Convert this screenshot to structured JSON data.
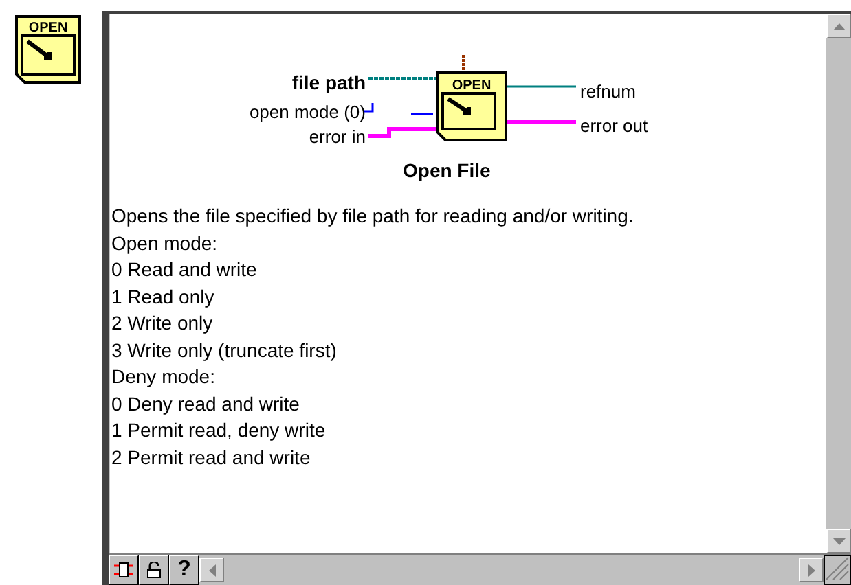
{
  "icon": {
    "label": "OPEN"
  },
  "diagram": {
    "node_label": "OPEN",
    "inputs": [
      {
        "label": "file path",
        "kind": "bold"
      },
      {
        "label": "open mode (0)",
        "kind": "plain"
      },
      {
        "label": "error in",
        "kind": "plain"
      }
    ],
    "outputs": [
      {
        "label": "refnum"
      },
      {
        "label": "error out"
      }
    ],
    "title": "Open File"
  },
  "description": [
    "Opens the file specified by file path for reading and/or writing.",
    "Open mode:",
    "0  Read and write",
    "1  Read only",
    "2  Write only",
    "3  Write only (truncate first)",
    "Deny mode:",
    "0  Deny read and write",
    "1  Permit read, deny write",
    "2  Permit read and write"
  ],
  "bottom_bar": {
    "help_button": "?"
  }
}
